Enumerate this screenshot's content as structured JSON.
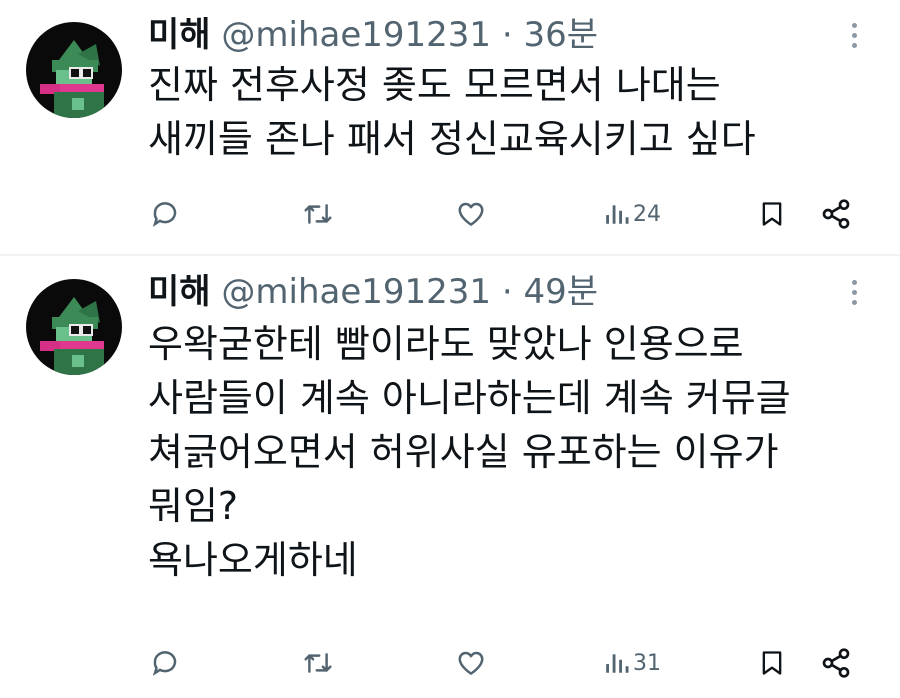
{
  "tweets": [
    {
      "name": "미해",
      "handle": "@mihae191231",
      "separator": "·",
      "time": "36분",
      "lines": [
        "진짜 전후사정 좆도 모르면서 나대는",
        "새끼들 존나 패서 정신교육시키고 싶다"
      ],
      "views": "24"
    },
    {
      "name": "미해",
      "handle": "@mihae191231",
      "separator": "·",
      "time": "49분",
      "lines": [
        "우왁굳한테 빰이라도 맞았나 인용으로",
        "사람들이 계속 아니라하는데 계속 커뮤글",
        "쳐긁어오면서 허위사실 유포하는 이유가",
        "뭐임?",
        "욕나오게하네"
      ],
      "views": "31"
    }
  ],
  "icons": {
    "reply": "reply-icon",
    "retweet": "retweet-icon",
    "like": "heart-icon",
    "views": "views-icon",
    "bookmark": "bookmark-icon",
    "share": "share-icon",
    "more": "more-icon"
  },
  "colors": {
    "text": "#0f1419",
    "secondary": "#536471",
    "divider": "#eff3f4"
  }
}
